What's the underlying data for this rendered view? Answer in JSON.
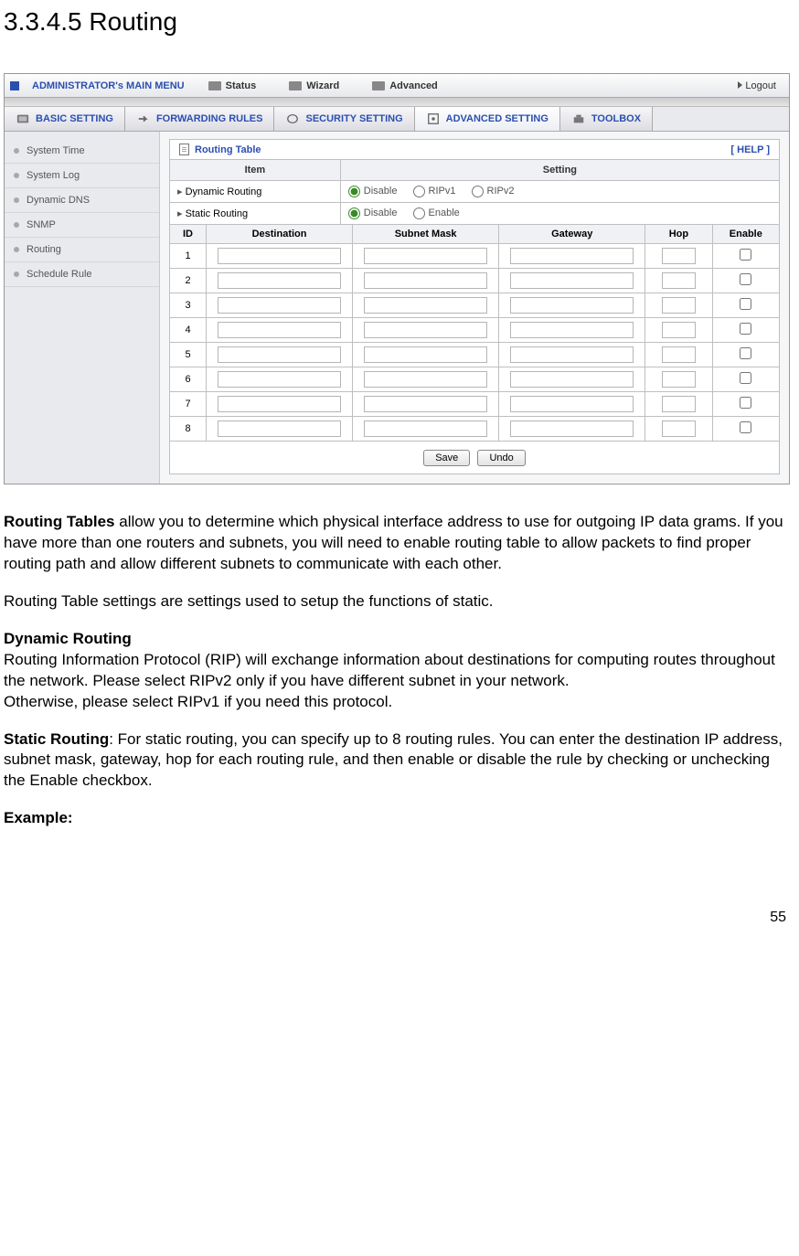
{
  "section_heading": "3.3.4.5 Routing",
  "topbar": {
    "title": "ADMINISTRATOR's MAIN MENU",
    "items": [
      "Status",
      "Wizard",
      "Advanced"
    ],
    "logout": "Logout"
  },
  "tabs": [
    "BASIC SETTING",
    "FORWARDING RULES",
    "SECURITY SETTING",
    "ADVANCED SETTING",
    "TOOLBOX"
  ],
  "active_tab_index": 3,
  "sidebar": {
    "items": [
      "System Time",
      "System Log",
      "Dynamic DNS",
      "SNMP",
      "Routing",
      "Schedule Rule"
    ]
  },
  "panel": {
    "title": "Routing Table",
    "help": "[ HELP ]",
    "header_item": "Item",
    "header_setting": "Setting",
    "rows": [
      {
        "label": "Dynamic Routing",
        "options": [
          "Disable",
          "RIPv1",
          "RIPv2"
        ],
        "selected": 0
      },
      {
        "label": "Static Routing",
        "options": [
          "Disable",
          "Enable"
        ],
        "selected": 0
      }
    ]
  },
  "route_table": {
    "headers": [
      "ID",
      "Destination",
      "Subnet Mask",
      "Gateway",
      "Hop",
      "Enable"
    ],
    "rows": [
      {
        "id": "1",
        "destination": "",
        "subnet": "",
        "gateway": "",
        "hop": "",
        "enable": false
      },
      {
        "id": "2",
        "destination": "",
        "subnet": "",
        "gateway": "",
        "hop": "",
        "enable": false
      },
      {
        "id": "3",
        "destination": "",
        "subnet": "",
        "gateway": "",
        "hop": "",
        "enable": false
      },
      {
        "id": "4",
        "destination": "",
        "subnet": "",
        "gateway": "",
        "hop": "",
        "enable": false
      },
      {
        "id": "5",
        "destination": "",
        "subnet": "",
        "gateway": "",
        "hop": "",
        "enable": false
      },
      {
        "id": "6",
        "destination": "",
        "subnet": "",
        "gateway": "",
        "hop": "",
        "enable": false
      },
      {
        "id": "7",
        "destination": "",
        "subnet": "",
        "gateway": "",
        "hop": "",
        "enable": false
      },
      {
        "id": "8",
        "destination": "",
        "subnet": "",
        "gateway": "",
        "hop": "",
        "enable": false
      }
    ]
  },
  "buttons": {
    "save": "Save",
    "undo": "Undo"
  },
  "doc": {
    "p1_lead": "Routing Tables",
    "p1_rest": " allow you to determine which physical interface address to use for outgoing IP data grams. If you have more than one routers and subnets, you will need to enable routing table to allow packets to find proper routing path and allow different subnets to communicate with each other.",
    "p2": "Routing Table settings are settings used to setup the functions of static.",
    "p3_head": "Dynamic Routing",
    "p3_body": "Routing Information Protocol (RIP) will exchange information about destinations for computing routes throughout the network. Please select RIPv2 only if you have different subnet in your network.",
    "p3_body2": "Otherwise, please select RIPv1 if you need this protocol.",
    "p4_head": "Static Routing",
    "p4_body": ": For static routing, you can specify up to 8 routing rules. You can enter the destination IP address, subnet mask, gateway, hop for each routing rule, and then enable or disable the rule by checking or unchecking the Enable checkbox.",
    "p5": "Example:"
  },
  "page_number": "55"
}
